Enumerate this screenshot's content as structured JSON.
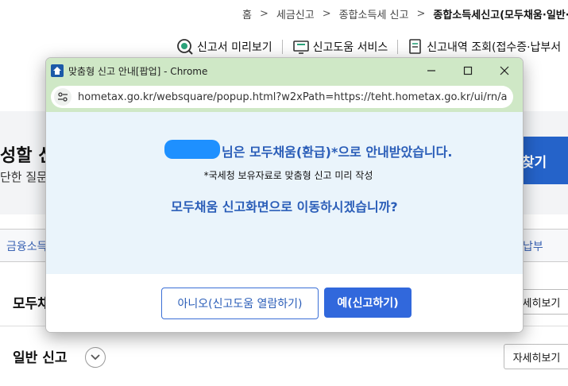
{
  "breadcrumb": {
    "items": [
      "홈",
      "세금신고",
      "종합소득세 신고",
      "종합소득세신고(모두채움·일반·"
    ],
    "separator": ">"
  },
  "toolbar": {
    "preview_label": "신고서 미리보기",
    "help_label": "신고도움 서비스",
    "history_label": "신고내역 조회(접수증·납부서"
  },
  "background": {
    "title": "성할 신",
    "subtitle": "단한 질문",
    "find_button": "찾기",
    "col_left": "금융소득",
    "col_right": "납부",
    "row1_title": "모두채",
    "row1_detail": "자세히보기",
    "row2_title": "일반 신고",
    "row2_detail": "자세히보기"
  },
  "popup": {
    "window_title": "맞춤형 신고 안내[팝업] - Chrome",
    "url": "hometax.go.kr/websquare/popup.html?w2xPath=https://teht.hometax.go.kr/ui/rn/a/...",
    "notice": "님은 모두채움(환급)*으로 안내받았습니다.",
    "subnote": "*국세청 보유자료로 맞춤형 신고 미리 작성",
    "question": "모두채움 신고화면으로 이동하시겠습니까?",
    "no_button": "아니오(신고도움 열람하기)",
    "yes_button": "예(신고하기)"
  },
  "colors": {
    "titlebar_bg": "#cfe8c6",
    "content_bg": "#eaf4fb",
    "accent_blue": "#2a5db8",
    "primary_button": "#3168dc",
    "redaction": "#1e90ff"
  }
}
